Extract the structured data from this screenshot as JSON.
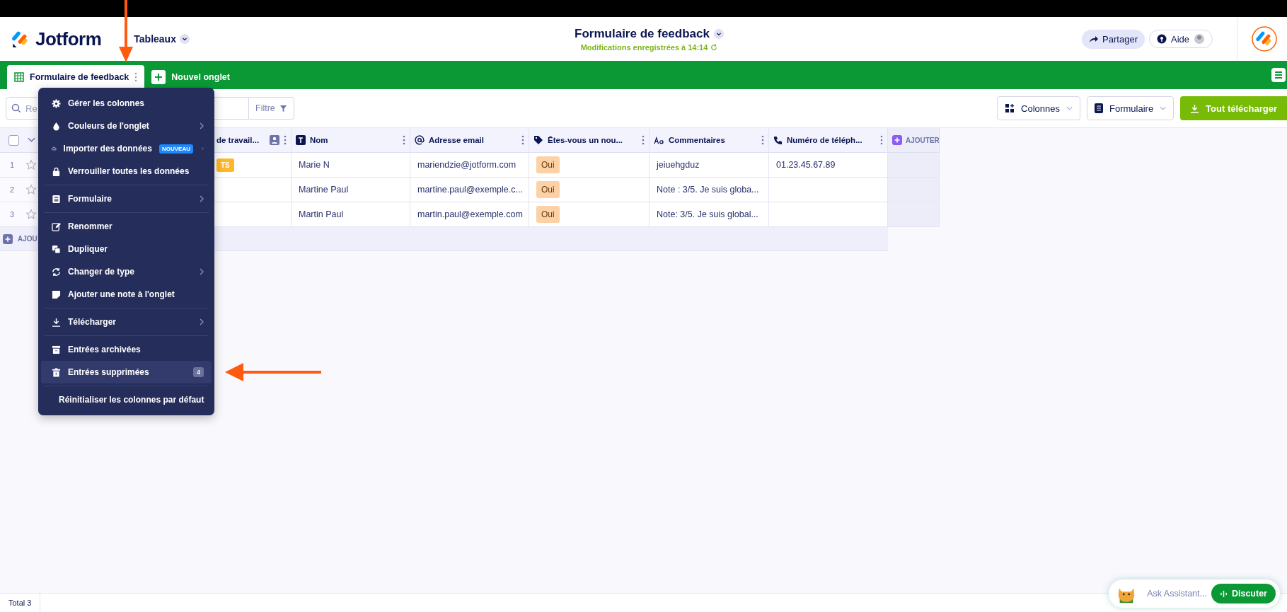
{
  "header": {
    "logo": "Jotform",
    "workspace": "Tableaux",
    "title": "Formulaire de feedback",
    "saved_status": "Modifications enregistrées à 14:14",
    "share_button": "Partager",
    "help_button": "Aide"
  },
  "tabs": [
    {
      "label": "Formulaire de feedback",
      "selected": true
    },
    {
      "label": "Nouvel onglet",
      "selected": false
    }
  ],
  "toolbar": {
    "search": {
      "placeholder": "Re"
    },
    "filter_button": "Filtre",
    "columns_button": "Colonnes",
    "form_button": "Formulaire",
    "download_button": "Tout télécharger"
  },
  "table": {
    "select_all_checked": false,
    "columns": [
      "de travail...",
      "Nom",
      "Adresse email",
      "Êtes-vous un nou...",
      "Commentaires",
      "Numéro de téléph..."
    ],
    "add_column": "AJOUTER",
    "rows": [
      {
        "number": "1",
        "column_2_tag": "TS",
        "name": "Marie N",
        "email": "mariendzie@jotform.com",
        "answer": "Oui",
        "comment": "jeiuehgduz",
        "phone": "01.23.45.67.89"
      },
      {
        "number": "2",
        "name": "Martine Paul",
        "email": "martine.paul@exemple.c...",
        "answer": "Oui",
        "comment": "Note : 3/5. Je suis globa..."
      },
      {
        "number": "3",
        "name": "Martin Paul",
        "email": "martin.paul@exemple.com",
        "answer": "Oui",
        "comment": "Note: 3/5. Je suis global..."
      }
    ],
    "add_row": "AJOU"
  },
  "menu": {
    "groups": [
      [
        {
          "label": "Gérer les colonnes",
          "submenu": false,
          "selected": false
        },
        {
          "label": "Couleurs de l'onglet",
          "submenu": true,
          "selected": false
        },
        {
          "label": "Importer des données",
          "badge": "NOUVEAU",
          "submenu": true,
          "selected": false
        },
        {
          "label": "Verrouiller toutes les données",
          "submenu": false,
          "selected": false
        }
      ],
      [
        {
          "label": "Formulaire",
          "submenu": true,
          "selected": false
        }
      ],
      [
        {
          "label": "Renommer",
          "submenu": false,
          "selected": false
        },
        {
          "label": "Dupliquer",
          "submenu": false,
          "selected": false
        },
        {
          "label": "Changer de type",
          "submenu": true,
          "selected": false
        },
        {
          "label": "Ajouter une note à l'onglet",
          "submenu": false,
          "selected": false
        }
      ],
      [
        {
          "label": "Télécharger",
          "submenu": true,
          "selected": false
        }
      ],
      [
        {
          "label": "Entrées archivées",
          "submenu": false,
          "selected": false
        },
        {
          "label": "Entrées supprimées",
          "count": "4",
          "submenu": false,
          "selected": true
        }
      ],
      [
        {
          "label": "Réinitialiser les colonnes par défaut",
          "submenu": false,
          "selected": false
        }
      ]
    ]
  },
  "footer": {
    "total": "Total 3"
  },
  "assistant": {
    "placeholder": "Ask Assistant...",
    "button": "Discuter"
  }
}
